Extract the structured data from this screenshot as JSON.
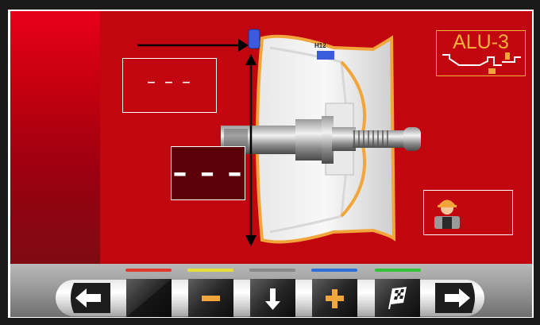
{
  "entry_fields": {
    "distance_value": "– – –",
    "diameter_value": "– – –"
  },
  "rim": {
    "program_label": "ALU-3",
    "position_label": "H12"
  },
  "toolbar": {
    "indicator_colors": [
      "#e23a2c",
      "#e8e03a",
      "#8a8a8a",
      "#2f6fdc",
      "#35c23a"
    ],
    "buttons": [
      {
        "name": "back-button",
        "icon": "arrow-left-icon"
      },
      {
        "name": "blank-button",
        "icon": "none"
      },
      {
        "name": "minus-button",
        "icon": "minus-icon"
      },
      {
        "name": "down-button",
        "icon": "arrow-down-icon"
      },
      {
        "name": "plus-button",
        "icon": "plus-icon"
      },
      {
        "name": "finish-button",
        "icon": "checkered-flag-icon"
      },
      {
        "name": "next-button",
        "icon": "arrow-right-icon"
      }
    ]
  },
  "colors": {
    "background": "#c20610",
    "accent": "#f7b33a",
    "measure_marker": "#3a5bdc"
  }
}
